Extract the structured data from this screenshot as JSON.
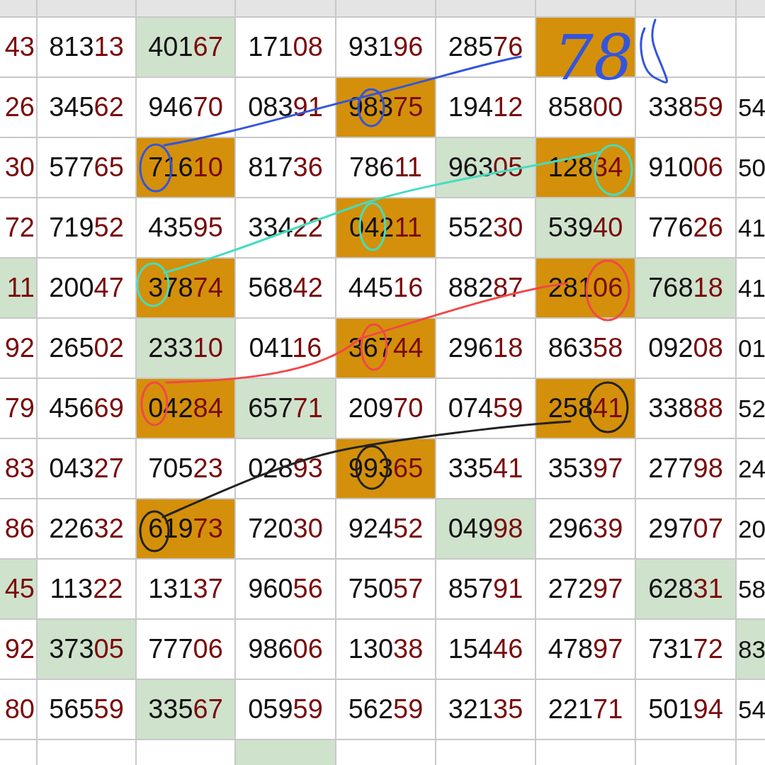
{
  "table": {
    "rows": [
      {
        "left_edge": {
          "text": "43"
        },
        "cells": [
          {
            "text": "81313"
          },
          {
            "text": "40167",
            "color": "#cfe2cc"
          },
          {
            "text": "17108"
          },
          {
            "text": "93196"
          },
          {
            "text": "28576"
          },
          {
            "color": "#d4900a"
          },
          {}
        ],
        "right_edge": {}
      },
      {
        "left_edge": {
          "text": "26"
        },
        "cells": [
          {
            "text": "34562"
          },
          {
            "text": "94670"
          },
          {
            "text": "08391"
          },
          {
            "text": "98375",
            "color": "#d4900a"
          },
          {
            "text": "19412"
          },
          {
            "text": "85800"
          },
          {
            "text": "33859"
          }
        ],
        "right_edge": {
          "text": "54"
        }
      },
      {
        "left_edge": {
          "text": "30"
        },
        "cells": [
          {
            "text": "57765"
          },
          {
            "text": "71610",
            "color": "#d4900a"
          },
          {
            "text": "81736"
          },
          {
            "text": "78611"
          },
          {
            "text": "96305",
            "color": "#cfe2cc"
          },
          {
            "text": "12834",
            "color": "#d4900a"
          },
          {
            "text": "91006"
          }
        ],
        "right_edge": {
          "text": "50"
        }
      },
      {
        "left_edge": {
          "text": "72"
        },
        "cells": [
          {
            "text": "71952"
          },
          {
            "text": "43595"
          },
          {
            "text": "33422"
          },
          {
            "text": "04211",
            "color": "#d4900a"
          },
          {
            "text": "55230"
          },
          {
            "text": "53940",
            "color": "#cfe2cc"
          },
          {
            "text": "77626"
          }
        ],
        "right_edge": {
          "text": "41"
        }
      },
      {
        "left_edge": {
          "text": "11",
          "color": "#cfe2cc"
        },
        "cells": [
          {
            "text": "20047"
          },
          {
            "text": "37874",
            "color": "#d4900a"
          },
          {
            "text": "56842"
          },
          {
            "text": "44516"
          },
          {
            "text": "88287"
          },
          {
            "text": "28106",
            "color": "#d4900a"
          },
          {
            "text": "76818",
            "color": "#cfe2cc"
          }
        ],
        "right_edge": {
          "text": "41"
        }
      },
      {
        "left_edge": {
          "text": "92"
        },
        "cells": [
          {
            "text": "26502"
          },
          {
            "text": "23310",
            "color": "#cfe2cc"
          },
          {
            "text": "04116"
          },
          {
            "text": "36744",
            "color": "#d4900a"
          },
          {
            "text": "29618"
          },
          {
            "text": "86358"
          },
          {
            "text": "09208"
          }
        ],
        "right_edge": {
          "text": "01"
        }
      },
      {
        "left_edge": {
          "text": "79"
        },
        "cells": [
          {
            "text": "45669"
          },
          {
            "text": "04284",
            "color": "#d4900a"
          },
          {
            "text": "65771",
            "color": "#cfe2cc"
          },
          {
            "text": "20970"
          },
          {
            "text": "07459"
          },
          {
            "text": "25841",
            "color": "#d4900a"
          },
          {
            "text": "33888"
          }
        ],
        "right_edge": {
          "text": "52"
        }
      },
      {
        "left_edge": {
          "text": "83"
        },
        "cells": [
          {
            "text": "04327"
          },
          {
            "text": "70523"
          },
          {
            "text": "02893"
          },
          {
            "text": "99365",
            "color": "#d4900a"
          },
          {
            "text": "33541"
          },
          {
            "text": "35397"
          },
          {
            "text": "27798"
          }
        ],
        "right_edge": {
          "text": "24"
        }
      },
      {
        "left_edge": {
          "text": "86"
        },
        "cells": [
          {
            "text": "22632"
          },
          {
            "text": "61973",
            "color": "#d4900a"
          },
          {
            "text": "72030"
          },
          {
            "text": "92452"
          },
          {
            "text": "04998",
            "color": "#cfe2cc"
          },
          {
            "text": "29639"
          },
          {
            "text": "29707"
          }
        ],
        "right_edge": {
          "text": "20"
        }
      },
      {
        "left_edge": {
          "text": "45",
          "color": "#cfe2cc"
        },
        "cells": [
          {
            "text": "11322"
          },
          {
            "text": "13137"
          },
          {
            "text": "96056"
          },
          {
            "text": "75057"
          },
          {
            "text": "85791"
          },
          {
            "text": "27297"
          },
          {
            "text": "62831",
            "color": "#cfe2cc"
          }
        ],
        "right_edge": {
          "text": "58"
        }
      },
      {
        "left_edge": {
          "text": "92"
        },
        "cells": [
          {
            "text": "37305",
            "color": "#cfe2cc"
          },
          {
            "text": "77706"
          },
          {
            "text": "98606"
          },
          {
            "text": "13038"
          },
          {
            "text": "15446"
          },
          {
            "text": "47897"
          },
          {
            "text": "73172"
          }
        ],
        "right_edge": {
          "text": "83",
          "color": "#cfe2cc"
        }
      },
      {
        "left_edge": {
          "text": "80"
        },
        "cells": [
          {
            "text": "56559"
          },
          {
            "text": "33567",
            "color": "#cfe2cc"
          },
          {
            "text": "05959"
          },
          {
            "text": "56259"
          },
          {
            "text": "32135"
          },
          {
            "text": "22171"
          },
          {
            "text": "50194"
          }
        ],
        "right_edge": {
          "text": "54"
        }
      },
      {
        "left_edge": {},
        "cells": [
          {},
          {},
          {
            "color": "#cfe2cc"
          },
          {},
          {},
          {},
          {}
        ],
        "right_edge": {}
      }
    ]
  },
  "handwritten_note": "78"
}
